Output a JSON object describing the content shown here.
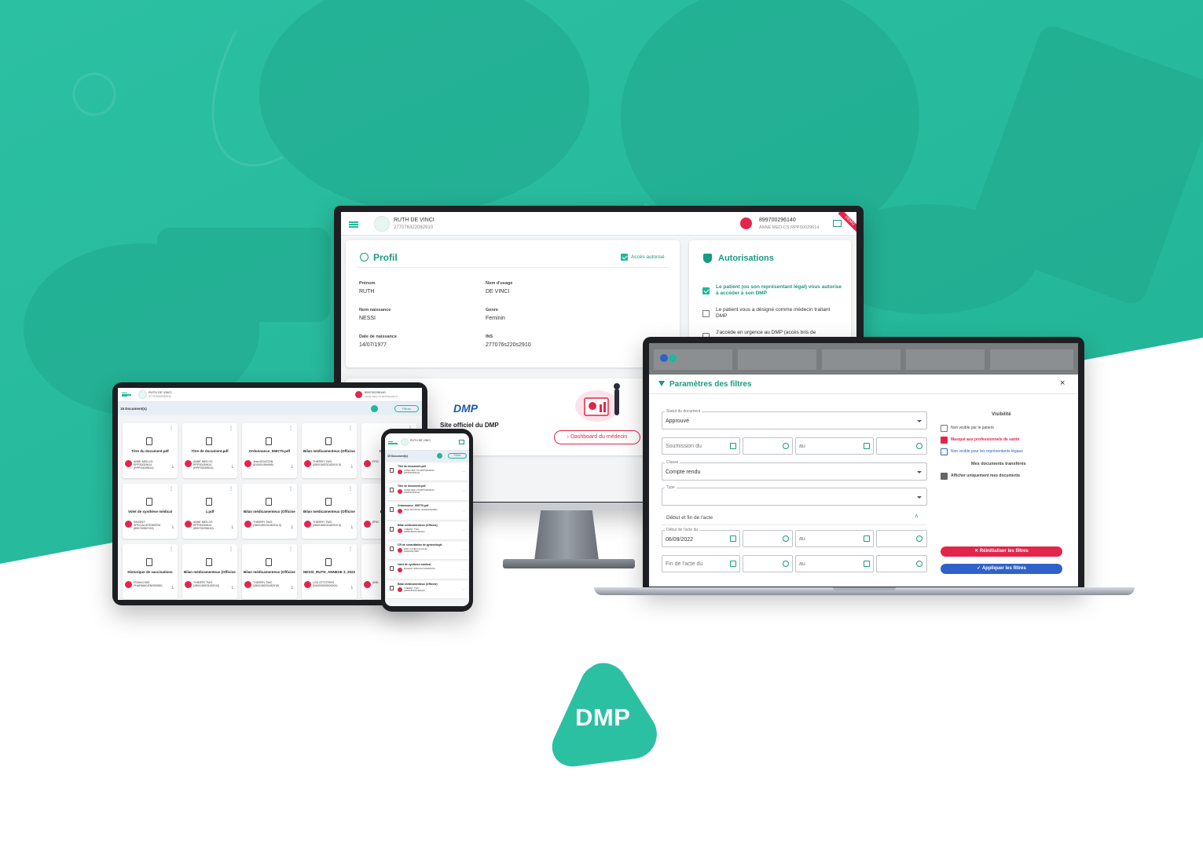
{
  "brand": {
    "logo_text": "DMP",
    "primary_color": "#1fb89a",
    "alert_color": "#e4254b",
    "link_color": "#2f62c8"
  },
  "patient": {
    "name": "RUTH DE VINCI",
    "id_number": "277076322082910"
  },
  "practitioner": {
    "phone": "899700296140",
    "name": "ANNE MED-CS RPPS0029614"
  },
  "desktop": {
    "corner_ribbon": "DÉMO",
    "profile": {
      "title": "Profil",
      "access_label": "Accès autorisé",
      "fields": [
        {
          "label": "Prénom",
          "value": "RUTH"
        },
        {
          "label": "Nom d'usage",
          "value": "DE VINCI"
        },
        {
          "label": "Nom naissance",
          "value": "NESSI"
        },
        {
          "label": "Genre",
          "value": "Feminin"
        },
        {
          "label": "Date de naissance",
          "value": "14/07/1977"
        },
        {
          "label": "INS",
          "value": "277076s220s2910"
        }
      ]
    },
    "authorizations": {
      "title": "Autorisations",
      "items": [
        {
          "text": "Le patient (ou son représentant légal) vous autorise à accéder à son DMP",
          "checked": true
        },
        {
          "text": "Le patient vous a désigné comme médecin traitant DMP",
          "checked": false
        },
        {
          "text": "J'accède en urgence au DMP (accès bris de",
          "checked": false
        }
      ]
    },
    "official_site": {
      "logo_text": "DMP",
      "label": "Site officiel du DMP"
    },
    "dashboard_button": "Dashboard du médecin"
  },
  "laptop": {
    "dialog_title": "Paramètres des filtres",
    "status_field": {
      "label": "Statut du document",
      "value": "Approuvé"
    },
    "submission_from": {
      "placeholder": "Soumission du"
    },
    "submission_to": {
      "placeholder": "au"
    },
    "class_field": {
      "label": "Classe",
      "value": "Compte rendu"
    },
    "type_field": {
      "label": "Type",
      "value": ""
    },
    "section_label": "Début et fin de l'acte",
    "act_start": {
      "label": "Début de l'acte du",
      "value": "06/09/2022"
    },
    "act_start_to": {
      "placeholder": "au"
    },
    "act_end": {
      "placeholder": "Fin de l'acte du"
    },
    "act_end_to": {
      "placeholder": "au"
    },
    "visibility": {
      "title": "Visibilité",
      "options": [
        {
          "label": "Non visible par le patient",
          "checked": false
        },
        {
          "label": "Masqué aux professionnels de santé",
          "checked": true
        },
        {
          "label": "Non visible pour les représentants légaux",
          "checked": false
        }
      ]
    },
    "transferred": {
      "title": "Mes documents transférés",
      "option": "Afficher uniquement mes documents",
      "checked": true
    },
    "reset_button": "Réinitialiser les filtres",
    "apply_button": "Appliquer les filtres"
  },
  "tablet": {
    "doc_count": "15 Document(s)",
    "filter_button": "Filtres",
    "tiles": [
      {
        "name": "Titre du document.pdf",
        "author": "ANNE MED-CS RPPS0029614 (RPPS0029614)"
      },
      {
        "name": "Titre de document.pdf",
        "author": "ANNE MED-CS RPPS0029614 (RPPS0029614)"
      },
      {
        "name": "Ordonnance_559770.pdf",
        "author": "Jean BOUSTAN (810001964996)"
      },
      {
        "name": "Bilan médicamenteux (Officine)",
        "author": "THIERRY TWO (2800189231182910 5)"
      },
      {
        "name": "CR de cons",
        "author": "ERIC"
      },
      {
        "name": "Volet de synthèse médical",
        "author": "RAGENT SPECIALISTE835700 (899700557024)"
      },
      {
        "name": "1.pdf",
        "author": "ANNE MED-CS RPPS0029614 (899700296140)"
      },
      {
        "name": "Bilan médicamenteux (Officine)",
        "author": "THIERRY TWO (2800189231182910 5)"
      },
      {
        "name": "Bilan médicamenteux (Officine)",
        "author": "THIERRY TWO (2800189231182910 5)"
      },
      {
        "name": "Bilan médi",
        "author": "ERIC"
      },
      {
        "name": "Historique de vaccinations",
        "author": "FRANCOISE PHARMACIEN0052801"
      },
      {
        "name": "Bilan médicamenteux (Officine)",
        "author": "THIERRY TWO (2800189231182910)"
      },
      {
        "name": "Bilan médicamenteux (Officine)",
        "author": "THIERRY TWO (2800189231182910)"
      },
      {
        "name": "NESSI_RUTH_ANNEXE 3_20220...",
        "author": "LOU OTTOTRES (000000000000001)"
      },
      {
        "name": "Prescripti",
        "author": "ANN"
      }
    ]
  },
  "phone": {
    "doc_count": "15 Document(s)",
    "filter_button": "Filtres",
    "rows": [
      {
        "title": "Titre du document.pdf",
        "author": "ANNE MED-CS RPPS0029614 (RPPS0029614)"
      },
      {
        "title": "Titre de document.pdf",
        "author": "ANNE MED-CS RPPS0029614 (RPPS0029614)"
      },
      {
        "title": "Ordonnance_559770.pdf",
        "author": "JEAN BOUSTAN (810001964996)"
      },
      {
        "title": "Bilan médicamenteux (Officine)",
        "author": "THIERRY TWO (2800189231182910)"
      },
      {
        "title": "CR de consultation de gynécologie",
        "author": "ERIC GYNECOLOGUE 810000637088"
      },
      {
        "title": "Volet de synthèse médical",
        "author": "RAGENT SPECIALISTE835700"
      },
      {
        "title": "Bilan médicamenteux (Officine)",
        "author": "THIERRY TWO (2800189231182910)"
      }
    ]
  }
}
